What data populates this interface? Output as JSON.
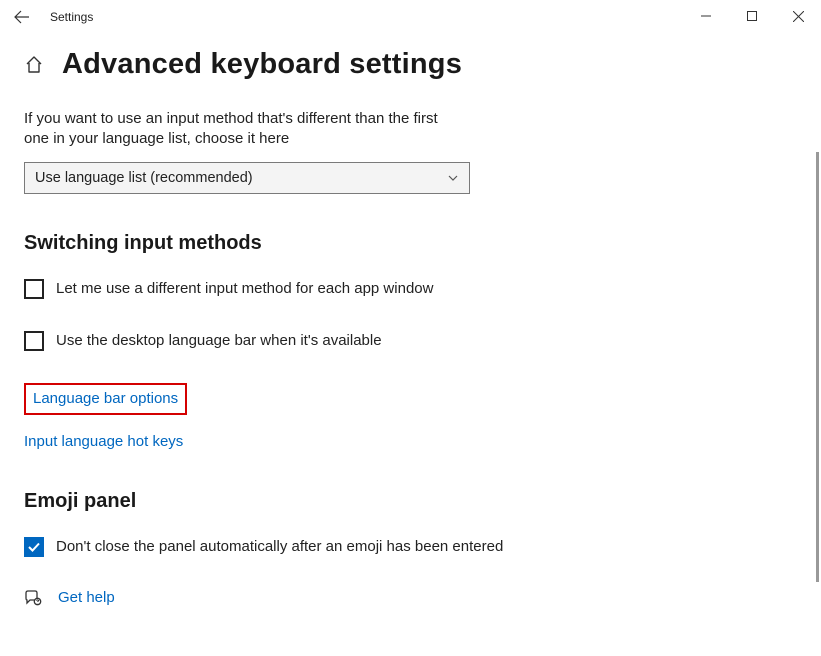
{
  "app": {
    "name": "Settings"
  },
  "page": {
    "title": "Advanced keyboard settings",
    "intro": "If you want to use an input method that's different than the first one in your language list, choose it here"
  },
  "input_select": {
    "value": "Use language list (recommended)"
  },
  "section_switching": {
    "heading": "Switching input methods",
    "cb1": "Let me use a different input method for each app window",
    "cb2": "Use the desktop language bar when it's available",
    "link1": "Language bar options",
    "link2": "Input language hot keys"
  },
  "section_emoji": {
    "heading": "Emoji panel",
    "cb1": "Don't close the panel automatically after an emoji has been entered"
  },
  "help": {
    "label": "Get help"
  }
}
